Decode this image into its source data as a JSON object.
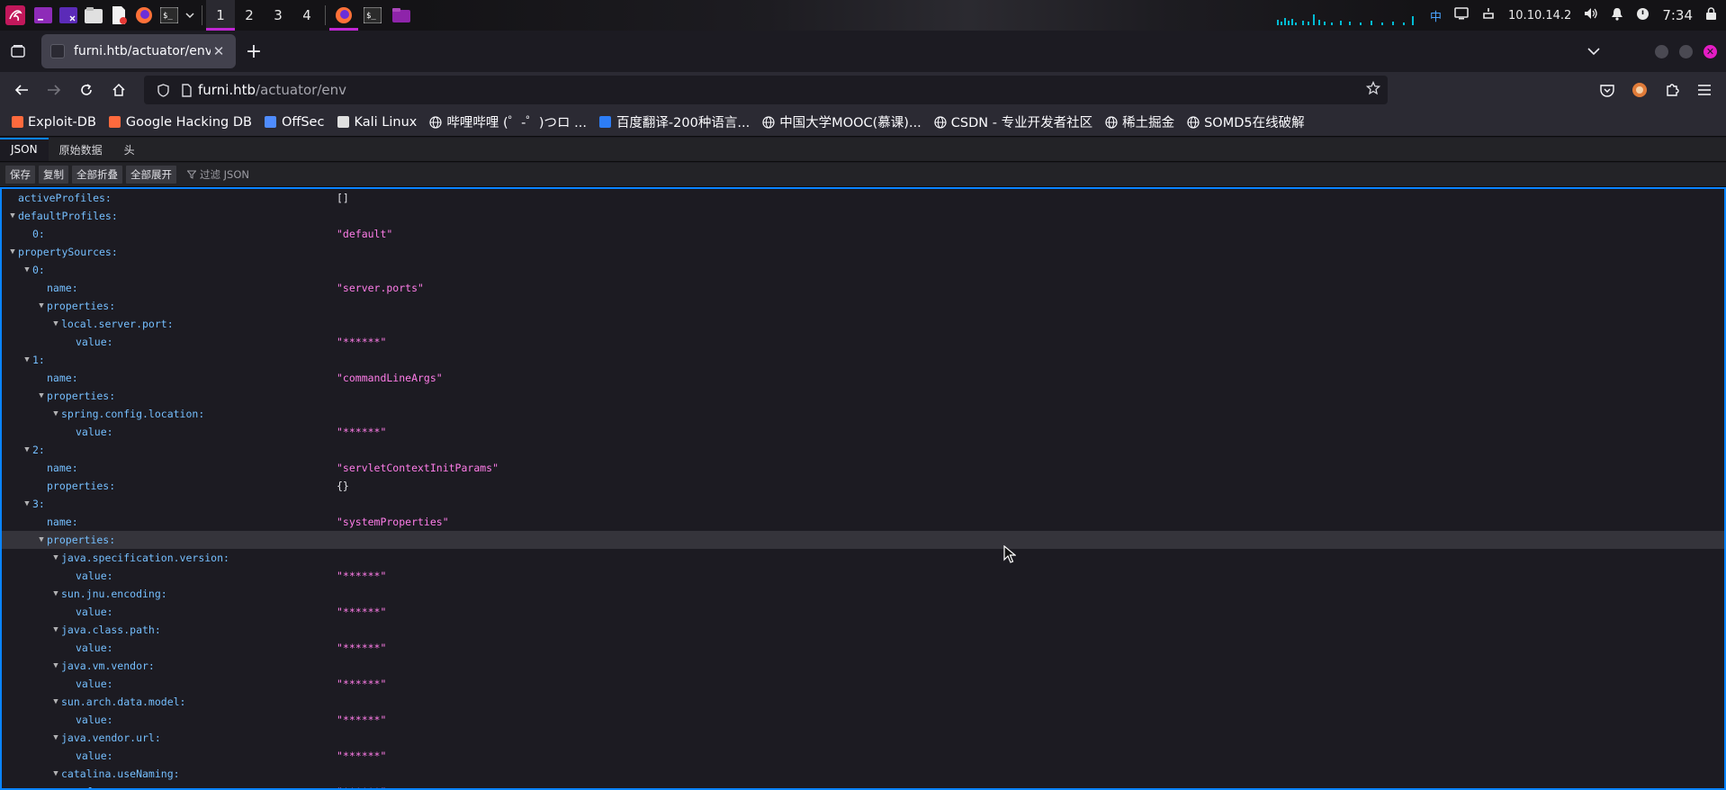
{
  "panel": {
    "workspaces": [
      "1",
      "2",
      "3",
      "4"
    ],
    "active_workspace": 0,
    "ime": "中",
    "ip": "10.10.14.2",
    "clock": "7:34",
    "icons": [
      "kali-dragon-icon",
      "terminal-icon",
      "terminal-alt-icon",
      "file-manager-icon",
      "text-editor-icon",
      "firefox-icon",
      "terminal-icon",
      "chevron-down-icon",
      "firefox-icon",
      "terminal-icon",
      "folder-icon",
      "display-icon",
      "network-icon",
      "volume-icon",
      "bell-icon",
      "power-icon",
      "lock-icon"
    ]
  },
  "browser": {
    "tab_title": "furni.htb/actuator/env",
    "url_host": "furni.htb",
    "url_path": "/actuator/env"
  },
  "bookmarks": [
    {
      "label": "Exploit-DB",
      "icon": "exploitdb-icon"
    },
    {
      "label": "Google Hacking DB",
      "icon": "ghdb-icon"
    },
    {
      "label": "OffSec",
      "icon": "offsec-icon"
    },
    {
      "label": "Kali Linux",
      "icon": "kali-icon"
    },
    {
      "label": "哔哩哔哩 (゜-゜)つロ ...",
      "icon": "globe-icon"
    },
    {
      "label": "百度翻译-200种语言...",
      "icon": "translate-icon"
    },
    {
      "label": "中国大学MOOC(慕课)...",
      "icon": "globe-icon"
    },
    {
      "label": "CSDN - 专业开发者社区",
      "icon": "globe-icon"
    },
    {
      "label": "稀土掘金",
      "icon": "globe-icon"
    },
    {
      "label": "SOMD5在线破解",
      "icon": "globe-icon"
    }
  ],
  "json_viewer": {
    "tabs": [
      "JSON",
      "原始数据",
      "头"
    ],
    "toolbar": [
      "保存",
      "复制",
      "全部折叠",
      "全部展开"
    ],
    "filter_placeholder": "过滤 JSON"
  },
  "tree": [
    {
      "depth": 0,
      "key": "activeProfiles:",
      "value": "[]",
      "toggle": false,
      "plain": true
    },
    {
      "depth": 0,
      "key": "defaultProfiles:",
      "value": "",
      "toggle": true
    },
    {
      "depth": 1,
      "key": "0:",
      "value": "\"default\"",
      "toggle": false
    },
    {
      "depth": 0,
      "key": "propertySources:",
      "value": "",
      "toggle": true
    },
    {
      "depth": 1,
      "key": "0:",
      "value": "",
      "toggle": true
    },
    {
      "depth": 2,
      "key": "name:",
      "value": "\"server.ports\"",
      "toggle": false
    },
    {
      "depth": 2,
      "key": "properties:",
      "value": "",
      "toggle": true
    },
    {
      "depth": 3,
      "key": "local.server.port:",
      "value": "",
      "toggle": true
    },
    {
      "depth": 4,
      "key": "value:",
      "value": "\"******\"",
      "toggle": false
    },
    {
      "depth": 1,
      "key": "1:",
      "value": "",
      "toggle": true
    },
    {
      "depth": 2,
      "key": "name:",
      "value": "\"commandLineArgs\"",
      "toggle": false
    },
    {
      "depth": 2,
      "key": "properties:",
      "value": "",
      "toggle": true
    },
    {
      "depth": 3,
      "key": "spring.config.location:",
      "value": "",
      "toggle": true
    },
    {
      "depth": 4,
      "key": "value:",
      "value": "\"******\"",
      "toggle": false
    },
    {
      "depth": 1,
      "key": "2:",
      "value": "",
      "toggle": true
    },
    {
      "depth": 2,
      "key": "name:",
      "value": "\"servletContextInitParams\"",
      "toggle": false
    },
    {
      "depth": 2,
      "key": "properties:",
      "value": "{}",
      "toggle": false,
      "plain": true
    },
    {
      "depth": 1,
      "key": "3:",
      "value": "",
      "toggle": true
    },
    {
      "depth": 2,
      "key": "name:",
      "value": "\"systemProperties\"",
      "toggle": false
    },
    {
      "depth": 2,
      "key": "properties:",
      "value": "",
      "toggle": true,
      "highlight": true
    },
    {
      "depth": 3,
      "key": "java.specification.version:",
      "value": "",
      "toggle": true
    },
    {
      "depth": 4,
      "key": "value:",
      "value": "\"******\"",
      "toggle": false
    },
    {
      "depth": 3,
      "key": "sun.jnu.encoding:",
      "value": "",
      "toggle": true
    },
    {
      "depth": 4,
      "key": "value:",
      "value": "\"******\"",
      "toggle": false
    },
    {
      "depth": 3,
      "key": "java.class.path:",
      "value": "",
      "toggle": true
    },
    {
      "depth": 4,
      "key": "value:",
      "value": "\"******\"",
      "toggle": false
    },
    {
      "depth": 3,
      "key": "java.vm.vendor:",
      "value": "",
      "toggle": true
    },
    {
      "depth": 4,
      "key": "value:",
      "value": "\"******\"",
      "toggle": false
    },
    {
      "depth": 3,
      "key": "sun.arch.data.model:",
      "value": "",
      "toggle": true
    },
    {
      "depth": 4,
      "key": "value:",
      "value": "\"******\"",
      "toggle": false
    },
    {
      "depth": 3,
      "key": "java.vendor.url:",
      "value": "",
      "toggle": true
    },
    {
      "depth": 4,
      "key": "value:",
      "value": "\"******\"",
      "toggle": false
    },
    {
      "depth": 3,
      "key": "catalina.useNaming:",
      "value": "",
      "toggle": true
    },
    {
      "depth": 4,
      "key": "value:",
      "value": "\"******\"",
      "toggle": false
    }
  ]
}
